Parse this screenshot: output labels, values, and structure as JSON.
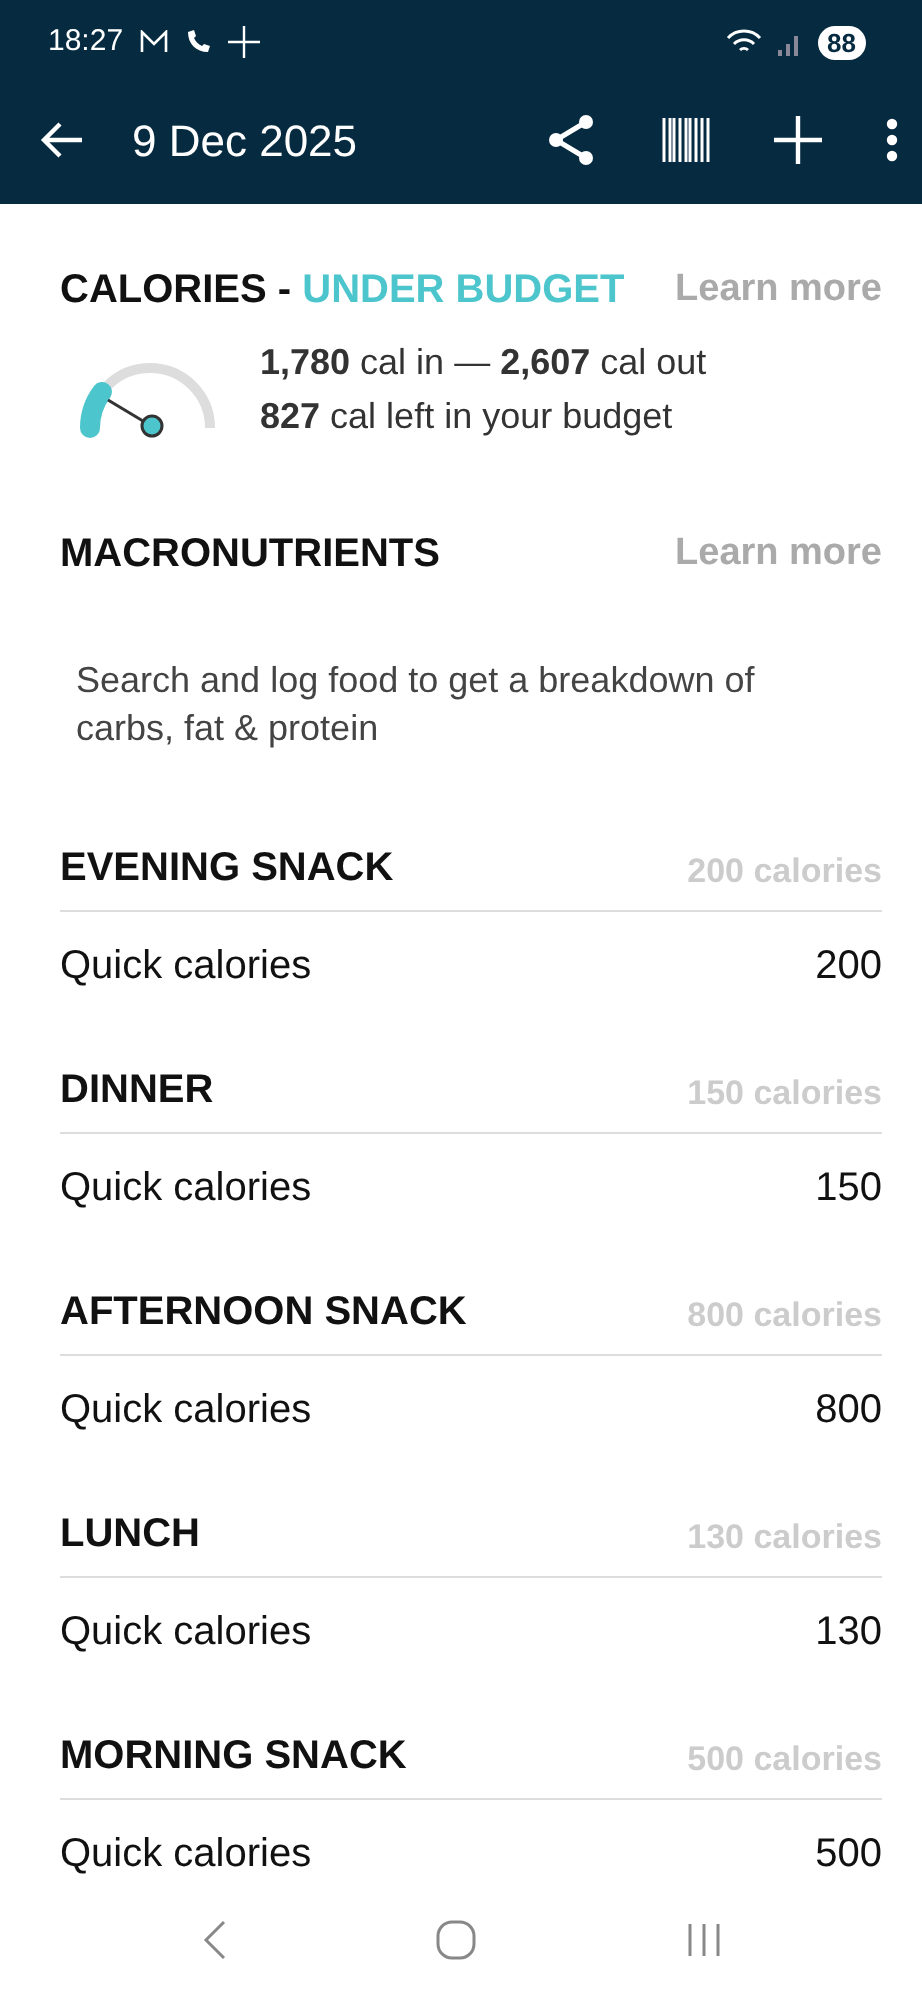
{
  "status_bar": {
    "time": "18:27",
    "battery": "88"
  },
  "app_bar": {
    "title": "9 Dec 2025"
  },
  "calories": {
    "title": "CALORIES - ",
    "status": "UNDER BUDGET",
    "learn_more": "Learn more",
    "line_1": "**1,780** cal in — **2,607** cal out",
    "line_2": "**827** cal left in your budget"
  },
  "macronutrients": {
    "title": "MACRONUTRIENTS",
    "learn_more": "Learn more",
    "message": "Search and log food to get a breakdown of carbs, fat & protein"
  },
  "meals": [
    {
      "name": "EVENING SNACK",
      "total": "200 calories",
      "entries": [
        {
          "label": "Quick calories",
          "value": "200"
        }
      ]
    },
    {
      "name": "DINNER",
      "total": "150 calories",
      "entries": [
        {
          "label": "Quick calories",
          "value": "150"
        }
      ]
    },
    {
      "name": "AFTERNOON SNACK",
      "total": "800 calories",
      "entries": [
        {
          "label": "Quick calories",
          "value": "800"
        }
      ]
    },
    {
      "name": "LUNCH",
      "total": "130 calories",
      "entries": [
        {
          "label": "Quick calories",
          "value": "130"
        }
      ]
    },
    {
      "name": "MORNING SNACK",
      "total": "500 calories",
      "entries": [
        {
          "label": "Quick calories",
          "value": "500"
        }
      ]
    }
  ]
}
